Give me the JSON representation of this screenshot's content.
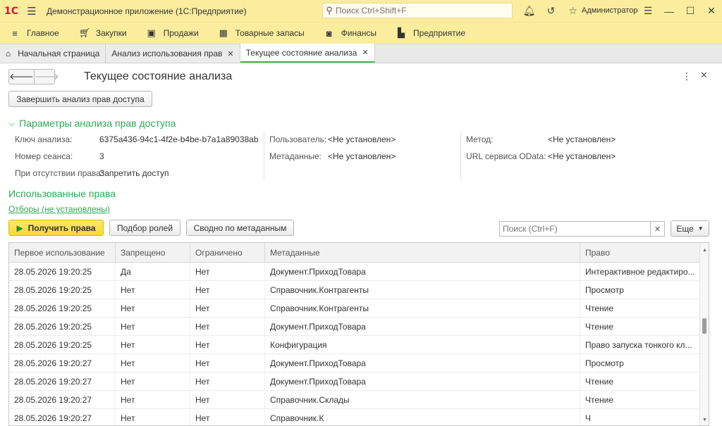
{
  "titlebar": {
    "logo": "1С",
    "app_title": "Демонстрационное приложение  (1С:Предприятие)",
    "search_placeholder": "Поиск Ctrl+Shift+F",
    "user": "Администратор"
  },
  "sections": [
    {
      "label": "Главное",
      "icon": "menu-lines-icon"
    },
    {
      "label": "Закупки",
      "icon": "cart-icon"
    },
    {
      "label": "Продажи",
      "icon": "bag-icon"
    },
    {
      "label": "Товарные запасы",
      "icon": "grid-icon"
    },
    {
      "label": "Финансы",
      "icon": "wallet-icon"
    },
    {
      "label": "Предприятие",
      "icon": "factory-icon"
    }
  ],
  "tabs": [
    {
      "label": "Начальная страница"
    },
    {
      "label": "Анализ использования прав"
    },
    {
      "label": "Текущее состояние анализа"
    }
  ],
  "form": {
    "title": "Текущее состояние анализа",
    "finish_button": "Завершить анализ прав доступа",
    "params_group_title": "Параметры анализа прав доступа",
    "params": {
      "key_label": "Ключ анализа:",
      "key_value": "6375a436-94c1-4f2e-b4be-b7a1a89038ab",
      "session_label": "Номер сеанса:",
      "session_value": "3",
      "absence_label": "При отсутствии права:",
      "absence_value": "Запретить доступ",
      "user_label": "Пользователь:",
      "user_value": "<Не установлен>",
      "metadata_label": "Метаданные:",
      "metadata_value": "<Не установлен>",
      "method_label": "Метод:",
      "method_value": "<Не установлен>",
      "odata_label": "URL сервиса OData:",
      "odata_value": "<Не установлен>"
    },
    "used_title": "Использованные права",
    "filters_link": "Отборы (не установлены)",
    "toolbar": {
      "get_rights": "Получить права",
      "roles": "Подбор ролей",
      "by_metadata": "Сводно по метаданным",
      "search_placeholder": "Поиск (Ctrl+F)",
      "more": "Еще"
    }
  },
  "table": {
    "columns": [
      "Первое использование",
      "Запрещено",
      "Ограничено",
      "Метаданные",
      "Право"
    ],
    "rows": [
      [
        "28.05.2026 19:20:25",
        "Да",
        "Нет",
        "Документ.ПриходТовара",
        "Интерактивное редактиро..."
      ],
      [
        "28.05.2026 19:20:25",
        "Нет",
        "Нет",
        "Справочник.Контрагенты",
        "Просмотр"
      ],
      [
        "28.05.2026 19:20:25",
        "Нет",
        "Нет",
        "Справочник.Контрагенты",
        "Чтение"
      ],
      [
        "28.05.2026 19:20:25",
        "Нет",
        "Нет",
        "Документ.ПриходТовара",
        "Чтение"
      ],
      [
        "28.05.2026 19:20:25",
        "Нет",
        "Нет",
        "Конфигурация",
        "Право запуска тонкого кл..."
      ],
      [
        "28.05.2026 19:20:27",
        "Нет",
        "Нет",
        "Документ.ПриходТовара",
        "Просмотр"
      ],
      [
        "28.05.2026 19:20:27",
        "Нет",
        "Нет",
        "Документ.ПриходТовара",
        "Чтение"
      ],
      [
        "28.05.2026 19:20:27",
        "Нет",
        "Нет",
        "Справочник.Склады",
        "Чтение"
      ],
      [
        "28.05.2026 19:20:27",
        "Нет",
        "Нет",
        "Справочник.К",
        "Ч"
      ]
    ]
  }
}
